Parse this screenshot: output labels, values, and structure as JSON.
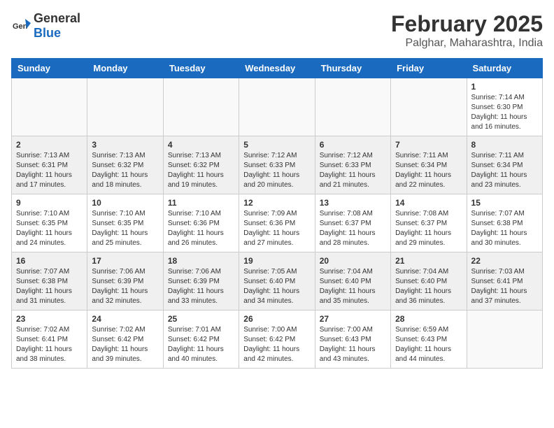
{
  "header": {
    "logo_general": "General",
    "logo_blue": "Blue",
    "main_title": "February 2025",
    "sub_title": "Palghar, Maharashtra, India"
  },
  "days_of_week": [
    "Sunday",
    "Monday",
    "Tuesday",
    "Wednesday",
    "Thursday",
    "Friday",
    "Saturday"
  ],
  "weeks": [
    [
      {
        "num": "",
        "info": ""
      },
      {
        "num": "",
        "info": ""
      },
      {
        "num": "",
        "info": ""
      },
      {
        "num": "",
        "info": ""
      },
      {
        "num": "",
        "info": ""
      },
      {
        "num": "",
        "info": ""
      },
      {
        "num": "1",
        "info": "Sunrise: 7:14 AM\nSunset: 6:30 PM\nDaylight: 11 hours and 16 minutes."
      }
    ],
    [
      {
        "num": "2",
        "info": "Sunrise: 7:13 AM\nSunset: 6:31 PM\nDaylight: 11 hours and 17 minutes."
      },
      {
        "num": "3",
        "info": "Sunrise: 7:13 AM\nSunset: 6:32 PM\nDaylight: 11 hours and 18 minutes."
      },
      {
        "num": "4",
        "info": "Sunrise: 7:13 AM\nSunset: 6:32 PM\nDaylight: 11 hours and 19 minutes."
      },
      {
        "num": "5",
        "info": "Sunrise: 7:12 AM\nSunset: 6:33 PM\nDaylight: 11 hours and 20 minutes."
      },
      {
        "num": "6",
        "info": "Sunrise: 7:12 AM\nSunset: 6:33 PM\nDaylight: 11 hours and 21 minutes."
      },
      {
        "num": "7",
        "info": "Sunrise: 7:11 AM\nSunset: 6:34 PM\nDaylight: 11 hours and 22 minutes."
      },
      {
        "num": "8",
        "info": "Sunrise: 7:11 AM\nSunset: 6:34 PM\nDaylight: 11 hours and 23 minutes."
      }
    ],
    [
      {
        "num": "9",
        "info": "Sunrise: 7:10 AM\nSunset: 6:35 PM\nDaylight: 11 hours and 24 minutes."
      },
      {
        "num": "10",
        "info": "Sunrise: 7:10 AM\nSunset: 6:35 PM\nDaylight: 11 hours and 25 minutes."
      },
      {
        "num": "11",
        "info": "Sunrise: 7:10 AM\nSunset: 6:36 PM\nDaylight: 11 hours and 26 minutes."
      },
      {
        "num": "12",
        "info": "Sunrise: 7:09 AM\nSunset: 6:36 PM\nDaylight: 11 hours and 27 minutes."
      },
      {
        "num": "13",
        "info": "Sunrise: 7:08 AM\nSunset: 6:37 PM\nDaylight: 11 hours and 28 minutes."
      },
      {
        "num": "14",
        "info": "Sunrise: 7:08 AM\nSunset: 6:37 PM\nDaylight: 11 hours and 29 minutes."
      },
      {
        "num": "15",
        "info": "Sunrise: 7:07 AM\nSunset: 6:38 PM\nDaylight: 11 hours and 30 minutes."
      }
    ],
    [
      {
        "num": "16",
        "info": "Sunrise: 7:07 AM\nSunset: 6:38 PM\nDaylight: 11 hours and 31 minutes."
      },
      {
        "num": "17",
        "info": "Sunrise: 7:06 AM\nSunset: 6:39 PM\nDaylight: 11 hours and 32 minutes."
      },
      {
        "num": "18",
        "info": "Sunrise: 7:06 AM\nSunset: 6:39 PM\nDaylight: 11 hours and 33 minutes."
      },
      {
        "num": "19",
        "info": "Sunrise: 7:05 AM\nSunset: 6:40 PM\nDaylight: 11 hours and 34 minutes."
      },
      {
        "num": "20",
        "info": "Sunrise: 7:04 AM\nSunset: 6:40 PM\nDaylight: 11 hours and 35 minutes."
      },
      {
        "num": "21",
        "info": "Sunrise: 7:04 AM\nSunset: 6:40 PM\nDaylight: 11 hours and 36 minutes."
      },
      {
        "num": "22",
        "info": "Sunrise: 7:03 AM\nSunset: 6:41 PM\nDaylight: 11 hours and 37 minutes."
      }
    ],
    [
      {
        "num": "23",
        "info": "Sunrise: 7:02 AM\nSunset: 6:41 PM\nDaylight: 11 hours and 38 minutes."
      },
      {
        "num": "24",
        "info": "Sunrise: 7:02 AM\nSunset: 6:42 PM\nDaylight: 11 hours and 39 minutes."
      },
      {
        "num": "25",
        "info": "Sunrise: 7:01 AM\nSunset: 6:42 PM\nDaylight: 11 hours and 40 minutes."
      },
      {
        "num": "26",
        "info": "Sunrise: 7:00 AM\nSunset: 6:42 PM\nDaylight: 11 hours and 42 minutes."
      },
      {
        "num": "27",
        "info": "Sunrise: 7:00 AM\nSunset: 6:43 PM\nDaylight: 11 hours and 43 minutes."
      },
      {
        "num": "28",
        "info": "Sunrise: 6:59 AM\nSunset: 6:43 PM\nDaylight: 11 hours and 44 minutes."
      },
      {
        "num": "",
        "info": ""
      }
    ]
  ]
}
